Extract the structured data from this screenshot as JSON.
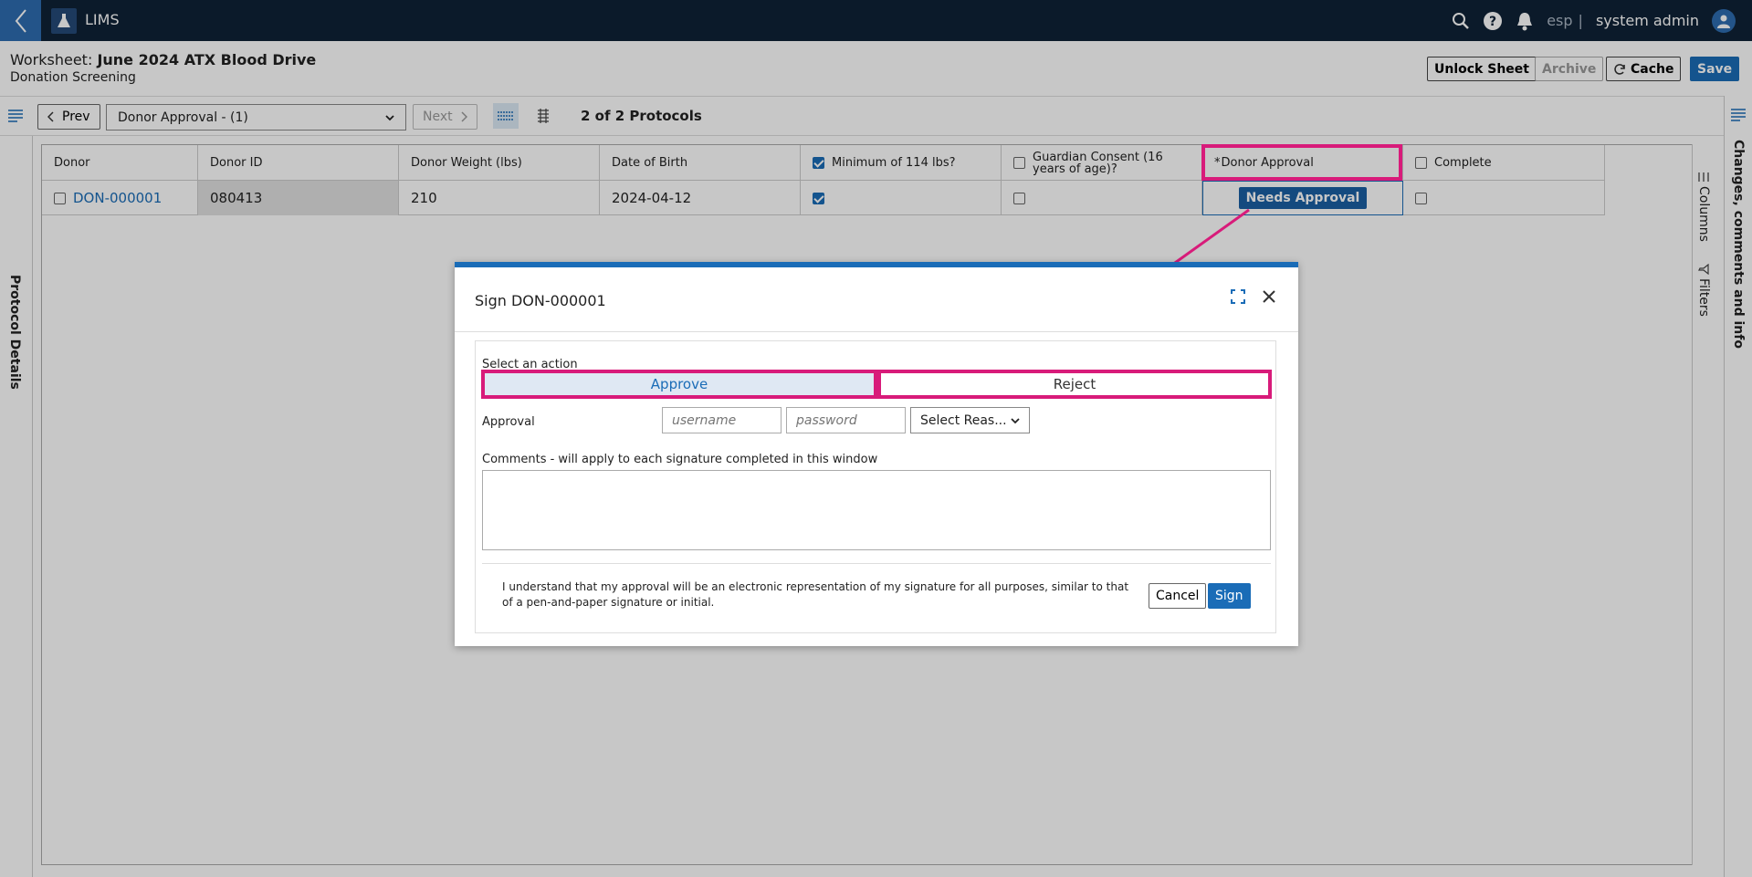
{
  "app": {
    "name": "LIMS"
  },
  "topbar": {
    "lang": "esp",
    "lang_sep": "|",
    "user": "system admin"
  },
  "worksheet": {
    "label": "Worksheet:",
    "name": "June 2024 ATX Blood Drive",
    "subtitle": "Donation Screening"
  },
  "header_buttons": {
    "unlock": "Unlock Sheet",
    "archive": "Archive",
    "cache": "Cache",
    "save": "Save"
  },
  "toolbar": {
    "prev": "Prev",
    "protocol_select": "Donor Approval - (1)",
    "next": "Next",
    "protocols_count": "2 of 2 Protocols"
  },
  "sidepanels": {
    "left": "Protocol Details",
    "right": "Changes, comments and info",
    "columns": "Columns",
    "filters": "Filters"
  },
  "table": {
    "columns": [
      "Donor",
      "Donor ID",
      "Donor Weight (lbs)",
      "Date of Birth",
      "Minimum of 114 lbs?",
      "Guardian Consent (16 years of age)?",
      "Donor Approval",
      "Complete"
    ],
    "required_marker": "*",
    "rows": [
      {
        "donor": "DON-000001",
        "donor_id": "080413",
        "weight": "210",
        "dob": "2024-04-12",
        "min_weight": true,
        "guardian_consent": false,
        "approval": "Needs Approval",
        "complete": false
      }
    ]
  },
  "dialog": {
    "title": "Sign DON-000001",
    "select_action_label": "Select an action",
    "approve": "Approve",
    "reject": "Reject",
    "approval_label": "Approval",
    "username_placeholder": "username",
    "password_placeholder": "password",
    "reason_select": "Select Reas...",
    "comments_label": "Comments - will apply to each signature completed in this window",
    "disclaimer": "I understand that my approval will be an electronic representation of my signature for all purposes, similar to that of a pen-and-paper signature or initial.",
    "cancel": "Cancel",
    "sign": "Sign"
  },
  "colors": {
    "topbar": "#0f2236",
    "primary": "#1a6cb7",
    "highlight": "#d81b7a"
  },
  "icons": [
    "chevron-left-icon",
    "flask-icon",
    "search-icon",
    "help-icon",
    "bell-icon",
    "user-icon",
    "refresh-icon",
    "list-view-icon",
    "grid-view-icon",
    "expand-icon",
    "close-icon",
    "filter-icon",
    "columns-icon",
    "panel-menu-icon"
  ]
}
